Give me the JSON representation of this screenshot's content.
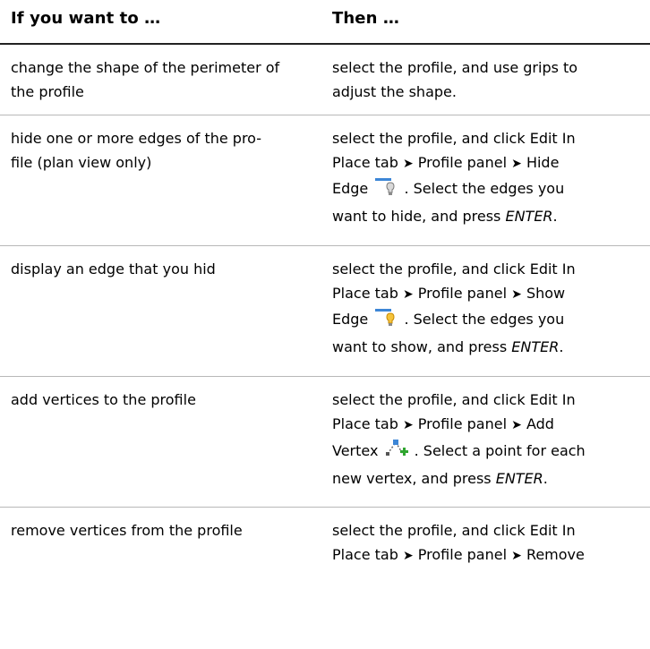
{
  "header": {
    "col1": "If you want to …",
    "col2": "Then …"
  },
  "rows": [
    {
      "action": "change the shape of the perimeter of the profile",
      "then_line1": "select the profile, and use grips to",
      "then_line2": "adjust the shape."
    },
    {
      "action_line1": "hide one or more edges of the pro-",
      "action_line2": "file (plan view only)",
      "then_line1": "select the profile, and click Edit In",
      "then_line2_a": "Place tab",
      "then_line2_b": "Profile panel",
      "then_line2_c": "Hide",
      "then_line3_a": "Edge",
      "then_line3_b": ". Select the edges you",
      "then_line4_a": "want to hide, and press ",
      "then_line4_b": "ENTER",
      "then_line4_c": ".",
      "icon": "hide-edge-icon"
    },
    {
      "action": "display an edge that you hid",
      "then_line1": "select the profile, and click Edit In",
      "then_line2_a": "Place tab",
      "then_line2_b": "Profile panel",
      "then_line2_c": "Show",
      "then_line3_a": "Edge",
      "then_line3_b": ". Select the edges you",
      "then_line4_a": "want to show, and press ",
      "then_line4_b": "ENTER",
      "then_line4_c": ".",
      "icon": "show-edge-icon"
    },
    {
      "action": "add vertices to the profile",
      "then_line1": "select the profile, and click Edit In",
      "then_line2_a": "Place tab",
      "then_line2_b": "Profile panel",
      "then_line2_c": "Add",
      "then_line3_a": "Vertex",
      "then_line3_b": ". Select a point for each",
      "then_line4_a": "new vertex, and press ",
      "then_line4_b": "ENTER",
      "then_line4_c": ".",
      "icon": "add-vertex-icon"
    },
    {
      "action": "remove vertices from the profile",
      "then_line1": "select the profile, and click Edit In",
      "then_line2_a": "Place tab",
      "then_line2_b": "Profile panel",
      "then_line2_c": "Remove"
    }
  ],
  "arrow_glyph": "➤"
}
